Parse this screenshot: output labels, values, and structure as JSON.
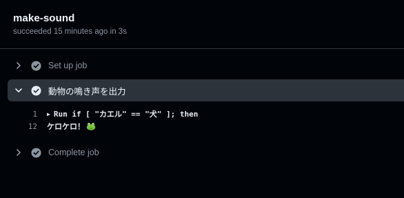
{
  "job": {
    "title": "make-sound",
    "status_text": "succeeded 15 minutes ago in 3s"
  },
  "steps": [
    {
      "label": "Set up job",
      "expanded": false,
      "status": "success"
    },
    {
      "label": "動物の鳴き声を出力",
      "expanded": true,
      "status": "success"
    },
    {
      "label": "Complete job",
      "expanded": false,
      "status": "success"
    }
  ],
  "log": {
    "lines": [
      {
        "number": "1",
        "text": "Run if [ \"カエル\" == \"犬\" ]; then",
        "collapsible": true
      },
      {
        "number": "12",
        "text": "ケロケロ！",
        "emoji": "frog-icon",
        "collapsible": false
      }
    ]
  },
  "colors": {
    "background": "#010409",
    "expanded_step_bg": "#2d333b",
    "muted_text": "#8b949e",
    "check_icon": "#8b949e"
  }
}
